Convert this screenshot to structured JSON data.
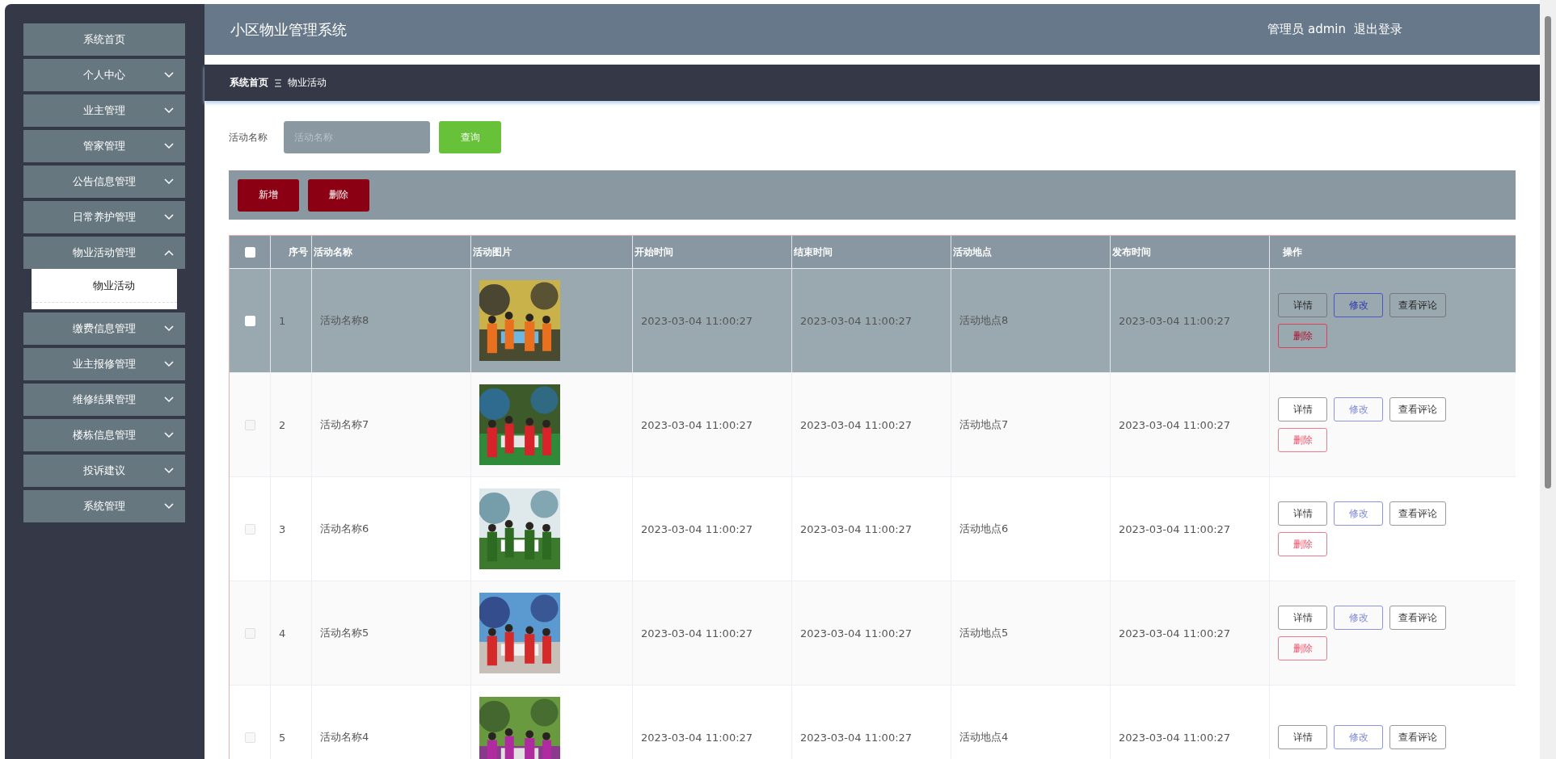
{
  "header": {
    "title": "小区物业管理系统",
    "user": "管理员 admin",
    "logout": "退出登录"
  },
  "sidebar": {
    "items": [
      {
        "label": "系统首页",
        "kind": "link"
      },
      {
        "label": "个人中心",
        "kind": "group",
        "expanded": false
      },
      {
        "label": "业主管理",
        "kind": "group",
        "expanded": false
      },
      {
        "label": "管家管理",
        "kind": "group",
        "expanded": false
      },
      {
        "label": "公告信息管理",
        "kind": "group",
        "expanded": false
      },
      {
        "label": "日常养护管理",
        "kind": "group",
        "expanded": false
      },
      {
        "label": "物业活动管理",
        "kind": "group",
        "expanded": true,
        "children": [
          {
            "label": "物业活动",
            "selected": true
          }
        ]
      },
      {
        "label": "缴费信息管理",
        "kind": "group",
        "expanded": false
      },
      {
        "label": "业主报修管理",
        "kind": "group",
        "expanded": false
      },
      {
        "label": "维修结果管理",
        "kind": "group",
        "expanded": false
      },
      {
        "label": "楼栋信息管理",
        "kind": "group",
        "expanded": false
      },
      {
        "label": "投诉建议",
        "kind": "group",
        "expanded": false
      },
      {
        "label": "系统管理",
        "kind": "group",
        "expanded": false
      }
    ]
  },
  "breadcrumb": [
    {
      "label": "系统首页"
    },
    {
      "label": "物业活动"
    }
  ],
  "search": {
    "label": "活动名称",
    "placeholder": "活动名称",
    "button": "查询"
  },
  "toolbar": [
    "新增",
    "删除"
  ],
  "table": {
    "header_checked": false,
    "columns": [
      "序号",
      "活动名称",
      "活动图片",
      "开始时间",
      "结束时间",
      "活动地点",
      "发布时间",
      "操作"
    ],
    "rows": [
      {
        "index": "1",
        "name": "活动名称8",
        "start": "2023-03-04 11:00:27",
        "end": "2023-03-04 11:00:27",
        "place": "活动地点8",
        "published": "2023-03-04 11:00:27",
        "highlighted": true,
        "checked": false,
        "actions": [
          {
            "label": "详情",
            "kind": "default"
          },
          {
            "label": "修改",
            "kind": "edit"
          },
          {
            "label": "查看评论",
            "kind": "default"
          },
          {
            "label": "删除",
            "kind": "danger"
          }
        ]
      },
      {
        "index": "2",
        "name": "活动名称7",
        "start": "2023-03-04 11:00:27",
        "end": "2023-03-04 11:00:27",
        "place": "活动地点7",
        "published": "2023-03-04 11:00:27",
        "highlighted": false,
        "checked": false,
        "actions": [
          {
            "label": "详情",
            "kind": "default"
          },
          {
            "label": "修改",
            "kind": "edit"
          },
          {
            "label": "查看评论",
            "kind": "default"
          },
          {
            "label": "删除",
            "kind": "danger"
          }
        ]
      },
      {
        "index": "3",
        "name": "活动名称6",
        "start": "2023-03-04 11:00:27",
        "end": "2023-03-04 11:00:27",
        "place": "活动地点6",
        "published": "2023-03-04 11:00:27",
        "highlighted": false,
        "checked": false,
        "actions": [
          {
            "label": "详情",
            "kind": "default"
          },
          {
            "label": "修改",
            "kind": "edit"
          },
          {
            "label": "查看评论",
            "kind": "default"
          },
          {
            "label": "删除",
            "kind": "danger"
          }
        ]
      },
      {
        "index": "4",
        "name": "活动名称5",
        "start": "2023-03-04 11:00:27",
        "end": "2023-03-04 11:00:27",
        "place": "活动地点5",
        "published": "2023-03-04 11:00:27",
        "highlighted": false,
        "checked": false,
        "actions": [
          {
            "label": "详情",
            "kind": "default"
          },
          {
            "label": "修改",
            "kind": "edit"
          },
          {
            "label": "查看评论",
            "kind": "default"
          },
          {
            "label": "删除",
            "kind": "danger"
          }
        ]
      },
      {
        "index": "5",
        "name": "活动名称4",
        "start": "2023-03-04 11:00:27",
        "end": "2023-03-04 11:00:27",
        "place": "活动地点4",
        "published": "2023-03-04 11:00:27",
        "highlighted": false,
        "checked": false,
        "actions": [
          {
            "label": "详情",
            "kind": "default"
          },
          {
            "label": "修改",
            "kind": "edit"
          },
          {
            "label": "查看评论",
            "kind": "default"
          }
        ]
      }
    ]
  }
}
